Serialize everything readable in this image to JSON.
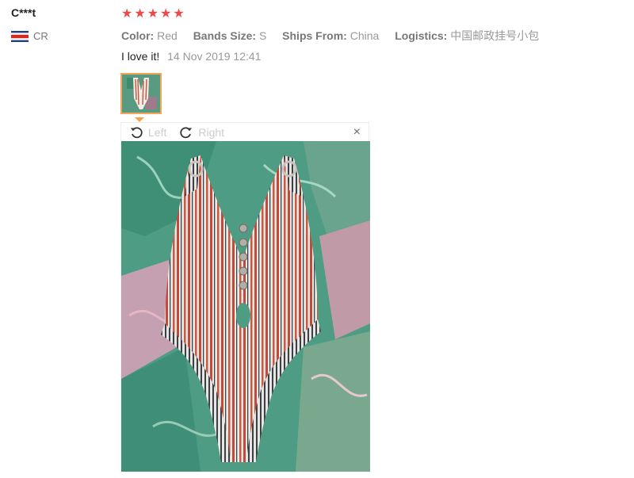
{
  "reviewer": {
    "name": "C***t",
    "country": "CR"
  },
  "rating": {
    "stars": 5
  },
  "attributes": [
    {
      "key": "Color:",
      "value": "Red"
    },
    {
      "key": "Bands Size:",
      "value": "S"
    },
    {
      "key": "Ships From:",
      "value": "China"
    },
    {
      "key": "Logistics:",
      "value": "中国邮政挂号小包"
    }
  ],
  "comment": {
    "text": "I love it!",
    "date": "14 Nov 2019 12:41"
  },
  "viewer": {
    "left_label": "Left",
    "right_label": "Right",
    "close_symbol": "×"
  },
  "colors": {
    "star": "#f04848",
    "thumb_border": "#f2a65a"
  }
}
